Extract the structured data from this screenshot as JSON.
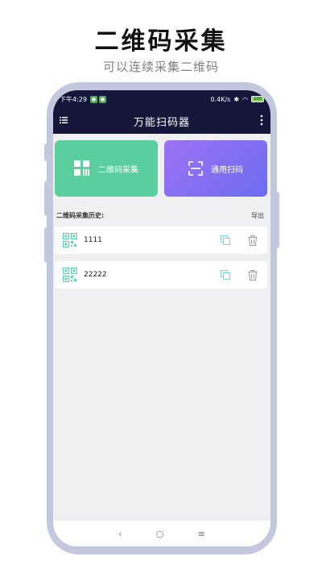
{
  "promo": {
    "title": "二维码采集",
    "subtitle": "可以连续采集二维码"
  },
  "status_bar": {
    "time": "下午4:29",
    "speed": "0.4K/s",
    "battery": "100"
  },
  "app": {
    "title": "万能扫码器"
  },
  "cards": {
    "qr_collect": {
      "label": "二维码采集",
      "color": "#5ccf9f"
    },
    "scan": {
      "label": "通用扫码",
      "color": "#8a6ff2"
    }
  },
  "history": {
    "title": "二维码采集历史:",
    "export_label": "导出",
    "items": [
      {
        "text": "1111"
      },
      {
        "text": "22222"
      }
    ]
  },
  "nav": {
    "back": "‹",
    "home": "○",
    "recents": "≡"
  },
  "colors": {
    "header_bg": "#14163a",
    "qr_icon": "#5ccfb5",
    "copy_icon": "#7fd3e6"
  }
}
